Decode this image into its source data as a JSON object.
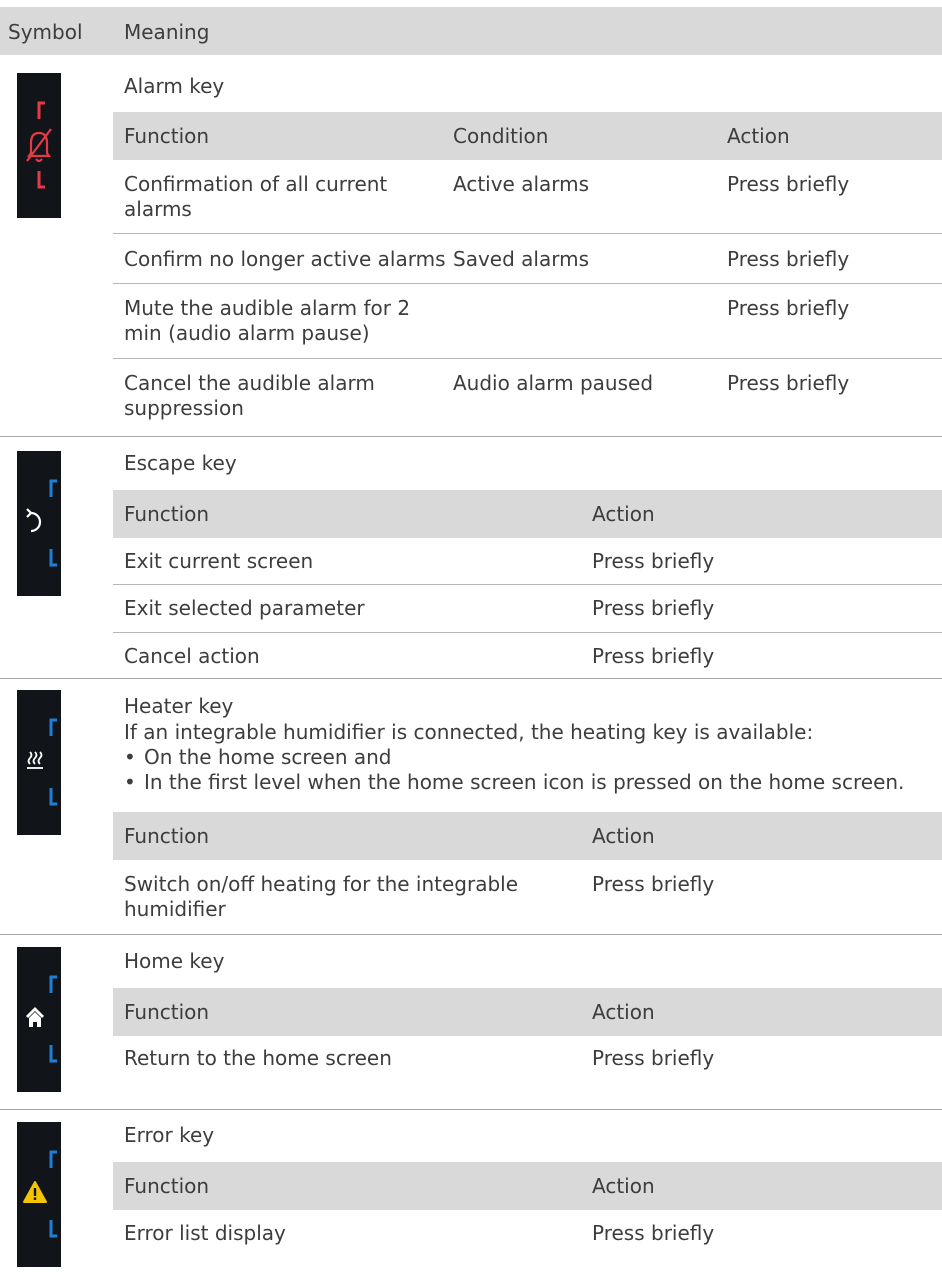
{
  "header": {
    "symbol": "Symbol",
    "meaning": "Meaning"
  },
  "colors": {
    "alarm": "#e63946",
    "bracket": "#1e7fd6",
    "warning": "#f5c400",
    "keybg": "#111418",
    "headerbg": "#d9d9d9"
  },
  "sections": [
    {
      "title": "Alarm key",
      "icon": "bell-muted-icon",
      "columns": [
        "Function",
        "Condition",
        "Action"
      ],
      "rows": [
        [
          "Confirmation of all current alarms",
          "Active alarms",
          "Press briefly"
        ],
        [
          "Confirm no longer active alarms",
          "Saved alarms",
          "Press briefly"
        ],
        [
          "Mute the audible alarm for 2 min (audio alarm pause)",
          "",
          "Press briefly"
        ],
        [
          "Cancel the audible alarm suppression",
          "Audio alarm paused",
          "Press briefly"
        ]
      ]
    },
    {
      "title": "Escape key",
      "icon": "undo-arrow-icon",
      "columns": [
        "Function",
        "Action"
      ],
      "rows": [
        [
          "Exit current screen",
          "Press briefly"
        ],
        [
          "Exit selected parameter",
          "Press briefly"
        ],
        [
          "Cancel action",
          "Press briefly"
        ]
      ]
    },
    {
      "title": "Heater key",
      "icon": "heater-icon",
      "intro": "If an integrable humidifier is connected, the heating key is available:",
      "bullets": [
        "On the home screen and",
        "In the first level when the home screen icon is pressed on the home screen."
      ],
      "columns": [
        "Function",
        "Action"
      ],
      "rows": [
        [
          "Switch on/off heating for the integrable humidifier",
          "Press briefly"
        ]
      ]
    },
    {
      "title": "Home key",
      "icon": "home-icon",
      "columns": [
        "Function",
        "Action"
      ],
      "rows": [
        [
          "Return to the home screen",
          "Press briefly"
        ]
      ]
    },
    {
      "title": "Error key",
      "icon": "warning-icon",
      "columns": [
        "Function",
        "Action"
      ],
      "rows": [
        [
          "Error list display",
          "Press briefly"
        ]
      ]
    }
  ]
}
